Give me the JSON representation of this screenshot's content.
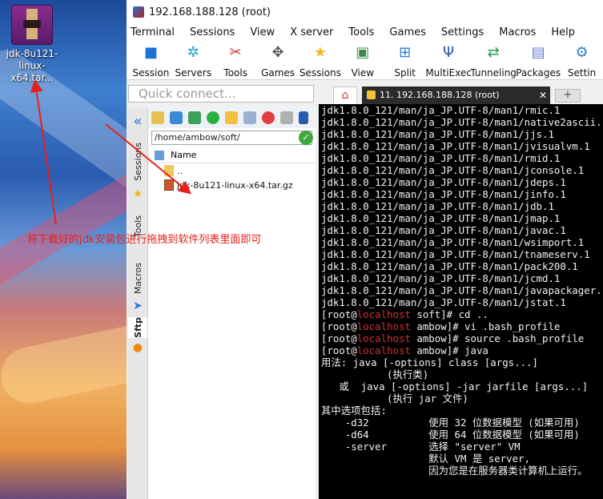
{
  "desktop": {
    "icon_label": "jdk-8u121-linux-x64.tar..."
  },
  "annotation": "将下载好的jdk安装包进行拖拽到软件列表里面即可",
  "window": {
    "title": "192.168.188.128 (root)"
  },
  "menu": [
    "Terminal",
    "Sessions",
    "View",
    "X server",
    "Tools",
    "Games",
    "Settings",
    "Macros",
    "Help"
  ],
  "toolbar": [
    {
      "label": "Session",
      "icon": "session-icon"
    },
    {
      "label": "Servers",
      "icon": "servers-icon"
    },
    {
      "label": "Tools",
      "icon": "tools-icon"
    },
    {
      "label": "Games",
      "icon": "games-icon"
    },
    {
      "label": "Sessions",
      "icon": "sessions-star-icon"
    },
    {
      "label": "View",
      "icon": "view-icon"
    },
    {
      "label": "Split",
      "icon": "split-icon"
    },
    {
      "label": "MultiExec",
      "icon": "multiexec-icon"
    },
    {
      "label": "Tunneling",
      "icon": "tunneling-icon"
    },
    {
      "label": "Packages",
      "icon": "packages-icon"
    },
    {
      "label": "Settin",
      "icon": "settings-icon"
    }
  ],
  "quick_connect": "Quick connect...",
  "side_tabs": [
    "Sessions",
    "Tools",
    "Macros",
    "Sftp"
  ],
  "sftp": {
    "path": "/home/ambow/soft/",
    "col_name": "Name",
    "files": [
      "..",
      "jdk-8u121-linux-x64.tar.gz"
    ]
  },
  "tab_active": "11. 192.168.188.128 (root)",
  "terminal_lines": [
    {
      "text": "jdk1.8.0_121/man/ja_JP.UTF-8/man1/rmic.1"
    },
    {
      "text": "jdk1.8.0_121/man/ja_JP.UTF-8/man1/native2ascii.1"
    },
    {
      "text": "jdk1.8.0_121/man/ja_JP.UTF-8/man1/jjs.1"
    },
    {
      "text": "jdk1.8.0_121/man/ja_JP.UTF-8/man1/jvisualvm.1"
    },
    {
      "text": "jdk1.8.0_121/man/ja_JP.UTF-8/man1/rmid.1"
    },
    {
      "text": "jdk1.8.0_121/man/ja_JP.UTF-8/man1/jconsole.1"
    },
    {
      "text": "jdk1.8.0_121/man/ja_JP.UTF-8/man1/jdeps.1"
    },
    {
      "text": "jdk1.8.0_121/man/ja_JP.UTF-8/man1/jinfo.1"
    },
    {
      "text": "jdk1.8.0_121/man/ja_JP.UTF-8/man1/jdb.1"
    },
    {
      "text": "jdk1.8.0_121/man/ja_JP.UTF-8/man1/jmap.1"
    },
    {
      "text": "jdk1.8.0_121/man/ja_JP.UTF-8/man1/javac.1"
    },
    {
      "text": "jdk1.8.0_121/man/ja_JP.UTF-8/man1/wsimport.1"
    },
    {
      "text": "jdk1.8.0_121/man/ja_JP.UTF-8/man1/tnameserv.1"
    },
    {
      "text": "jdk1.8.0_121/man/ja_JP.UTF-8/man1/pack200.1"
    },
    {
      "text": "jdk1.8.0_121/man/ja_JP.UTF-8/man1/jcmd.1"
    },
    {
      "text": "jdk1.8.0_121/man/ja_JP.UTF-8/man1/javapackager.1"
    },
    {
      "text": "jdk1.8.0_121/man/ja_JP.UTF-8/man1/jstat.1"
    },
    {
      "pre": "[root@",
      "host": "localhost",
      "post": " soft]# cd .."
    },
    {
      "pre": "[root@",
      "host": "localhost",
      "post": " ambow]# vi .bash_profile"
    },
    {
      "pre": "[root@",
      "host": "localhost",
      "post": " ambow]# source .bash_profile"
    },
    {
      "pre": "[root@",
      "host": "localhost",
      "post": " ambow]# java"
    },
    {
      "text": "用法: java [-options] class [args...]"
    },
    {
      "text": "           (执行类)"
    },
    {
      "text": "   或  java [-options] -jar jarfile [args...]"
    },
    {
      "text": "           (执行 jar 文件)"
    },
    {
      "text": "其中选项包括:"
    },
    {
      "text": "    -d32          使用 32 位数据模型 (如果可用)"
    },
    {
      "text": "    -d64          使用 64 位数据模型 (如果可用)"
    },
    {
      "text": "    -server       选择 \"server\" VM"
    },
    {
      "text": "                  默认 VM 是 server,"
    },
    {
      "text": "                  因为您是在服务器类计算机上运行。"
    }
  ]
}
